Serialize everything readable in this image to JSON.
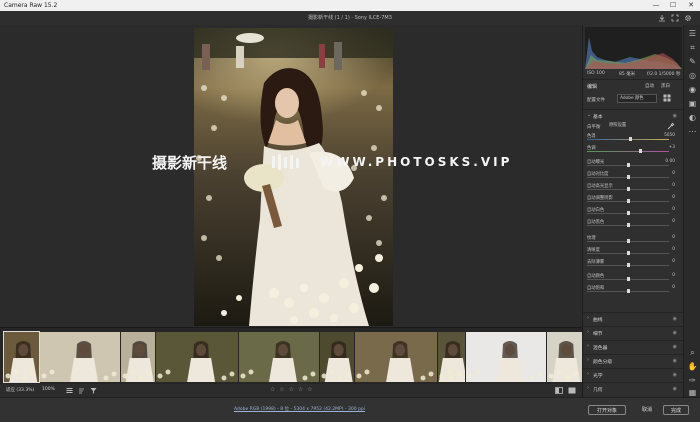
{
  "window": {
    "title": "Camera Raw 15.2",
    "min": "—",
    "max": "☐",
    "close": "✕"
  },
  "header": {
    "filename": "摄影新干线 (1 / 1) · Sony ILCE-7M3",
    "save_icon": "download-icon",
    "expand_icon": "fullscreen-icon",
    "settings_icon": "gear-icon"
  },
  "watermark": {
    "cn": "摄影新干线",
    "url": "WWW.PHOTOSKS.VIP"
  },
  "panel": {
    "exif_left": "ISO 100",
    "exif_mid": "85 毫米",
    "exif_right": "f/2.0   1/5000 秒",
    "edit_title": "编辑",
    "auto_label": "自动",
    "bw_label": "黑白",
    "profile_label": "配置文件",
    "profile_value": "Adobe 颜色",
    "basic_title": "基本",
    "wb_label": "白平衡",
    "wb_value": "原照设置",
    "temp_label": "色温",
    "temp_value": "5050",
    "tint_label": "色调",
    "tint_value": "+3",
    "sliders": [
      {
        "label": "自动曝光",
        "value": "0.00",
        "pos": 0.5
      },
      {
        "label": "自动对比度",
        "value": "0",
        "pos": 0.5
      },
      {
        "label": "自动高光显示",
        "value": "0",
        "pos": 0.5
      },
      {
        "label": "自动调整阴影",
        "value": "0",
        "pos": 0.5
      },
      {
        "label": "自动白色",
        "value": "0",
        "pos": 0.5
      },
      {
        "label": "自动黑色",
        "value": "0",
        "pos": 0.5
      }
    ],
    "sliders2": [
      {
        "label": "纹理",
        "value": "0",
        "pos": 0.5
      },
      {
        "label": "清晰度",
        "value": "0",
        "pos": 0.5
      },
      {
        "label": "去除薄雾",
        "value": "0",
        "pos": 0.5
      }
    ],
    "sliders3": [
      {
        "label": "自动颜色",
        "value": "0",
        "pos": 0.5
      },
      {
        "label": "自动饱和",
        "value": "0",
        "pos": 0.5
      }
    ],
    "sections": [
      "曲线",
      "细节",
      "混色器",
      "颜色分级",
      "光学",
      "几何"
    ]
  },
  "toolbar": {
    "mode": "适应 (33.3%)",
    "zoom": "100%",
    "stars": "☆ ☆ ☆ ☆ ☆"
  },
  "footer": {
    "info": "Adobe RGB (1998) - 8 位 - 5304 x 7952 (42.2MP) - 300 ppi",
    "open": "打开对象",
    "cancel": "取消",
    "done": "完成"
  }
}
